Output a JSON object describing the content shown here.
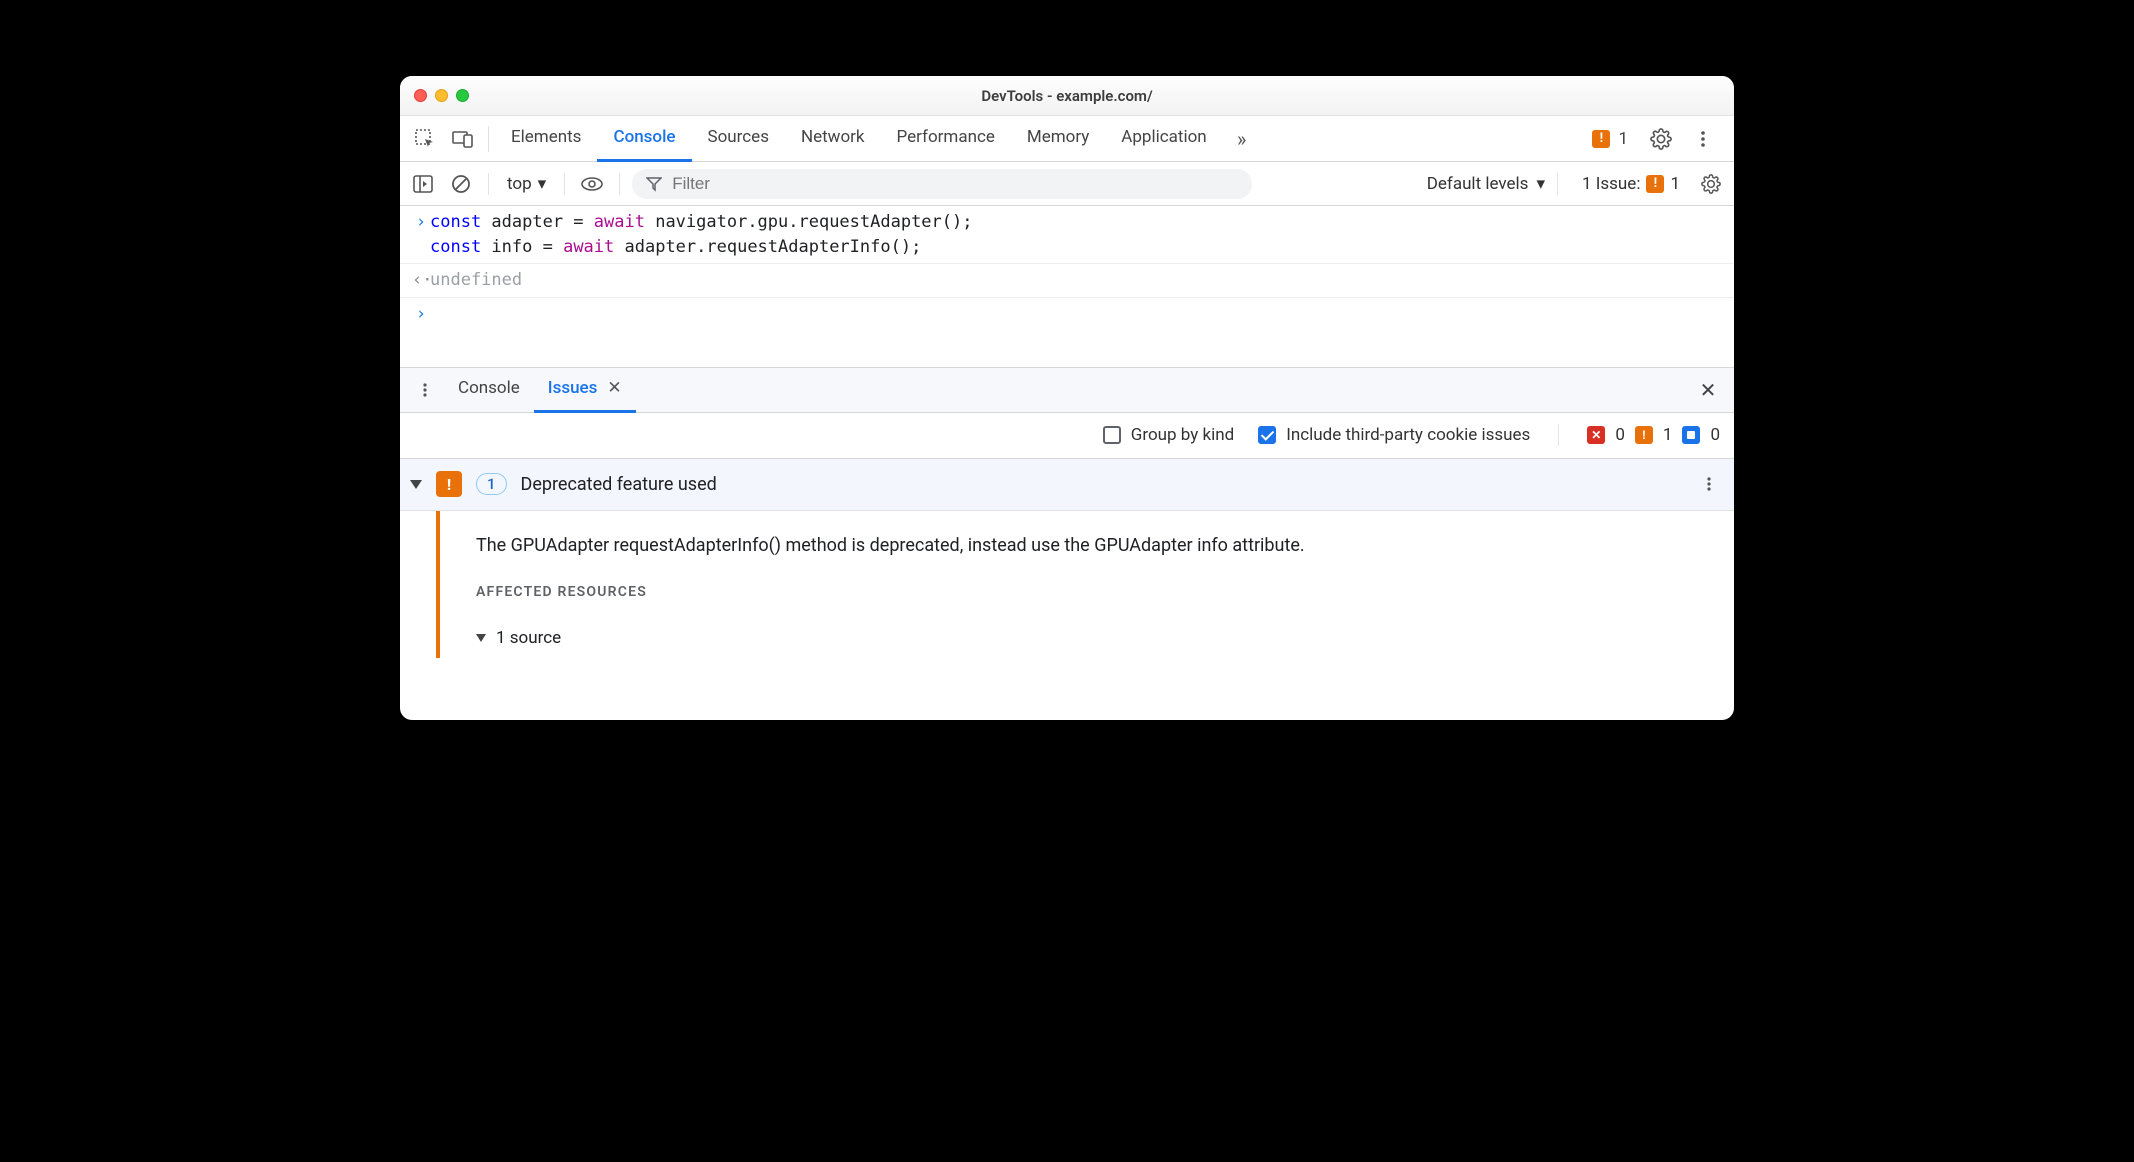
{
  "window": {
    "title": "DevTools - example.com/"
  },
  "tabs": {
    "items": [
      "Elements",
      "Console",
      "Sources",
      "Network",
      "Performance",
      "Memory",
      "Application"
    ],
    "active": "Console",
    "overflow_icon": "chevrons-right-icon",
    "badge_count": "1"
  },
  "filterbar": {
    "context": "top",
    "filter_placeholder": "Filter",
    "levels": "Default levels",
    "issues_label": "1 Issue:",
    "issues_count": "1"
  },
  "console": {
    "input_code": "const adapter = await navigator.gpu.requestAdapter();\nconst info = await adapter.requestAdapterInfo();",
    "output": "undefined"
  },
  "drawer": {
    "tabs": [
      "Console",
      "Issues"
    ],
    "active": "Issues"
  },
  "issues_toolbar": {
    "group_by_kind": {
      "label": "Group by kind",
      "checked": false
    },
    "include_third_party": {
      "label": "Include third-party cookie issues",
      "checked": true
    },
    "counts": {
      "errors": "0",
      "warnings": "1",
      "info": "0"
    }
  },
  "issue": {
    "count": "1",
    "title": "Deprecated feature used",
    "description": "The GPUAdapter requestAdapterInfo() method is deprecated, instead use the GPUAdapter info attribute.",
    "resources_label": "AFFECTED RESOURCES",
    "source_line": "1 source"
  }
}
